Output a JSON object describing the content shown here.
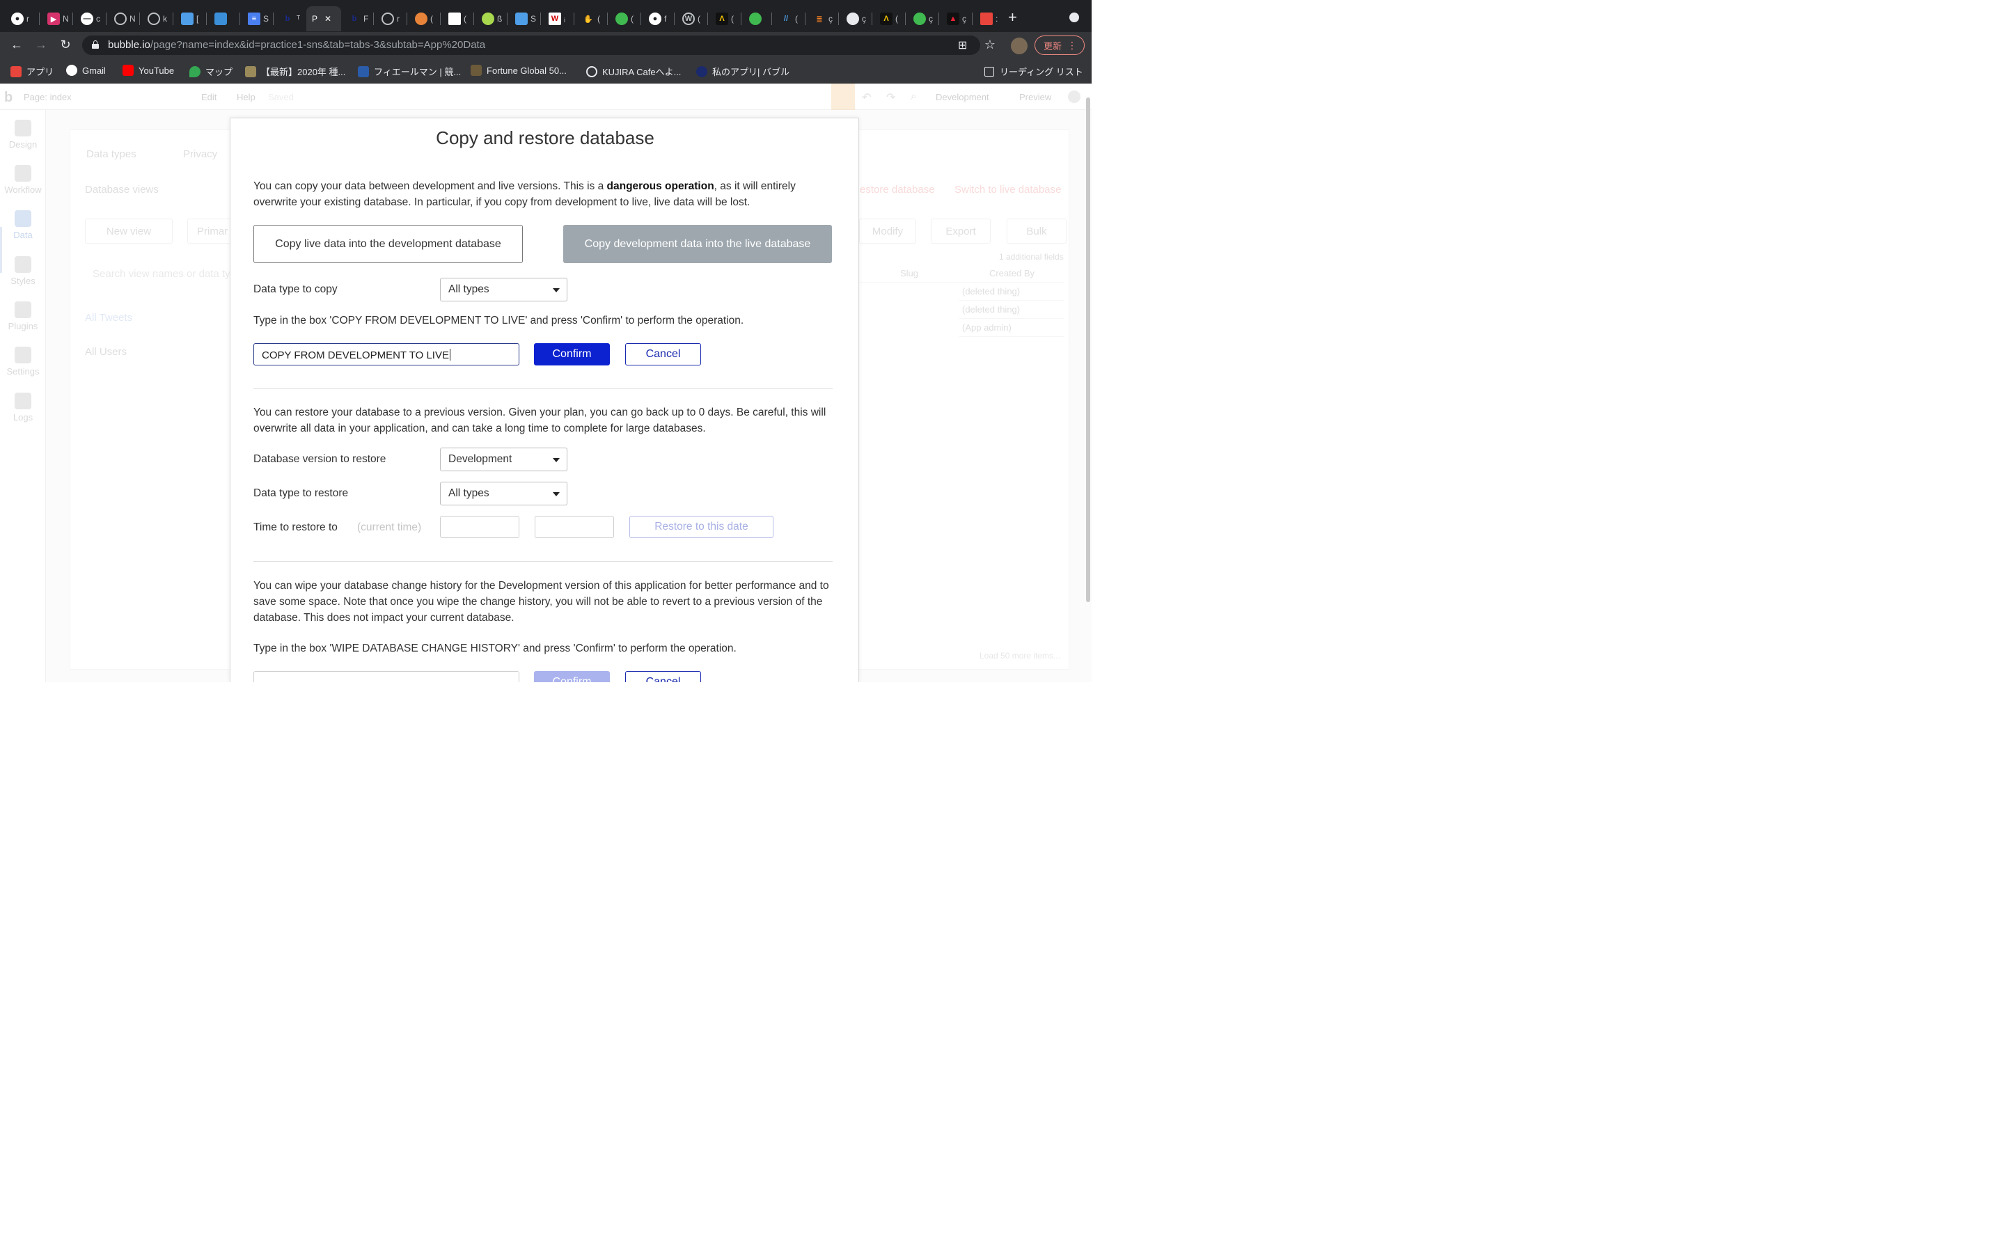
{
  "browser": {
    "active_tab_title": "P",
    "url_domain": "bubble.io",
    "url_path": "/page?name=index&id=practice1-sns&tab=tabs-3&subtab=App%20Data",
    "update_button_label": "更新",
    "bookmarks": [
      {
        "label": "アプリ",
        "icon": "apps-grid-icon",
        "color": "#e8453c"
      },
      {
        "label": "Gmail",
        "icon": "google-icon",
        "color": "#4285f4"
      },
      {
        "label": "YouTube",
        "icon": "youtube-icon",
        "color": "#ff0000"
      },
      {
        "label": "マップ",
        "icon": "maps-pin-icon",
        "color": "#34a853"
      },
      {
        "label": "【最新】2020年 種...",
        "icon": "site-icon",
        "color": "#9b8a5a"
      },
      {
        "label": "フィエールマン | 競...",
        "icon": "site-icon",
        "color": "#2a5caa"
      },
      {
        "label": "Fortune Global 50...",
        "icon": "site-icon",
        "color": "#6b5b3a"
      },
      {
        "label": "KUJIRA Cafeへよ...",
        "icon": "globe-icon",
        "color": "#e8eaed"
      },
      {
        "label": "私のアプリ| バブル",
        "icon": "bubble-icon",
        "color": "#1a2a6c"
      }
    ],
    "reading_list_label": "リーディング リスト"
  },
  "editor": {
    "page_label": "Page: index",
    "menu": [
      "Edit",
      "Help",
      "Saved"
    ],
    "dev_label": "Development",
    "preview_label": "Preview",
    "sidebar": [
      "Design",
      "Workflow",
      "Data",
      "Styles",
      "Plugins",
      "Settings",
      "Logs"
    ],
    "tabs": [
      "Data types",
      "Privacy"
    ],
    "database_views_label": "Database views",
    "new_view_label": "New view",
    "primary_label": "Primar",
    "search_placeholder": "Search view names or data ty",
    "views": [
      "All Tweets",
      "All Users"
    ],
    "restore_link": "estore database",
    "switch_link": "Switch to live database",
    "action_buttons": [
      "Modify",
      "Export",
      "Bulk"
    ],
    "additional_fields": "1 additional fields",
    "columns": [
      "Slug",
      "Created By"
    ],
    "created_by_values": [
      "(deleted thing)",
      "(deleted thing)",
      "(App admin)"
    ],
    "load_more": "Load 50 more items..."
  },
  "modal": {
    "title": "Copy and restore database",
    "intro_before": "You can copy your data between development and live versions. This is a ",
    "intro_bold": "dangerous operation",
    "intro_after": ", as it will entirely overwrite your existing database. In particular, if you copy from development to live, live data will be lost.",
    "copy_live_to_dev_label": "Copy live data into the development database",
    "copy_dev_to_live_label": "Copy development data into the live database",
    "data_type_to_copy_label": "Data type to copy",
    "data_type_to_copy_value": "All types",
    "copy_instruction": "Type in the box 'COPY FROM DEVELOPMENT TO LIVE' and press 'Confirm' to perform the operation.",
    "copy_input_value": "COPY FROM DEVELOPMENT TO LIVE",
    "confirm_label": "Confirm",
    "cancel_label": "Cancel",
    "restore_text": "You can restore your database to a previous version. Given your plan, you can go back up to 0 days. Be careful, this will overwrite all data in your application, and can take a long time to complete for large databases.",
    "db_version_label": "Database version to restore",
    "db_version_value": "Development",
    "data_type_to_restore_label": "Data type to restore",
    "data_type_to_restore_value": "All types",
    "time_to_restore_label": "Time to restore to",
    "current_time_placeholder": "(current time)",
    "restore_button_label": "Restore to this date",
    "wipe_text": "You can wipe your database change history for the Development version of this application for better performance and to save some space. Note that once you wipe the change history, you will not be able to revert to a previous version of the database. This does not impact your current database.",
    "wipe_instruction": "Type in the box 'WIPE DATABASE CHANGE HISTORY' and press 'Confirm' to perform the operation.",
    "wipe_confirm_label": "Confirm",
    "wipe_cancel_label": "Cancel"
  }
}
